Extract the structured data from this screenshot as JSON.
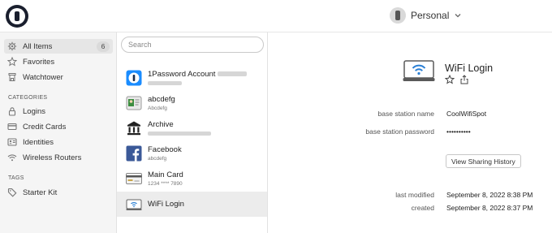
{
  "header": {
    "vault_name": "Personal"
  },
  "sidebar": {
    "all_items": {
      "label": "All Items",
      "count": "6"
    },
    "favorites": "Favorites",
    "watchtower": "Watchtower",
    "categories_header": "CATEGORIES",
    "categories": [
      "Logins",
      "Credit Cards",
      "Identities",
      "Wireless Routers"
    ],
    "tags_header": "TAGS",
    "tags": [
      "Starter Kit"
    ]
  },
  "search": {
    "placeholder": "Search"
  },
  "items": [
    {
      "title": "1Password Account",
      "subtitle": "",
      "icon": "onepassword-icon"
    },
    {
      "title": "abcdefg",
      "subtitle": "Abcdefg",
      "icon": "identity-card-icon"
    },
    {
      "title": "Archive",
      "subtitle": "",
      "icon": "bank-icon"
    },
    {
      "title": "Facebook",
      "subtitle": "abcdefg",
      "icon": "facebook-icon"
    },
    {
      "title": "Main Card",
      "subtitle": "1234 **** 7890",
      "icon": "credit-card-icon"
    },
    {
      "title": "WiFi Login",
      "subtitle": "",
      "icon": "wifi-router-icon",
      "selected": true
    }
  ],
  "detail": {
    "title": "WiFi Login",
    "fields": [
      {
        "label": "base station name",
        "value": "CoolWifiSpot"
      },
      {
        "label": "base station password",
        "value": "••••••••••"
      }
    ],
    "share_button": "View Sharing History",
    "meta": [
      {
        "label": "last modified",
        "value": "September 8, 2022 8:38 PM"
      },
      {
        "label": "created",
        "value": "September 8, 2022 8:37 PM"
      }
    ]
  },
  "colors": {
    "accent": "#1a8cff",
    "facebook": "#3b5998",
    "sidebar_bg": "#f5f5f5",
    "selected_bg": "#ececec"
  }
}
